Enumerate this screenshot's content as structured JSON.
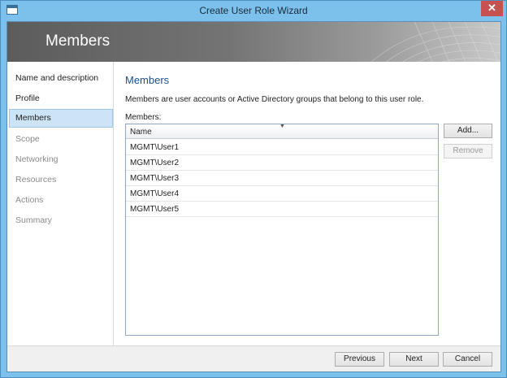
{
  "window": {
    "title": "Create User Role Wizard",
    "close_glyph": "✕"
  },
  "banner": {
    "title": "Members"
  },
  "nav": {
    "items": [
      {
        "label": "Name and description",
        "state": "enabled"
      },
      {
        "label": "Profile",
        "state": "enabled"
      },
      {
        "label": "Members",
        "state": "selected"
      },
      {
        "label": "Scope",
        "state": "disabled"
      },
      {
        "label": "Networking",
        "state": "disabled"
      },
      {
        "label": "Resources",
        "state": "disabled"
      },
      {
        "label": "Actions",
        "state": "disabled"
      },
      {
        "label": "Summary",
        "state": "disabled"
      }
    ]
  },
  "content": {
    "section_title": "Members",
    "description": "Members are user accounts or Active Directory groups that belong to this user role.",
    "members_label": "Members:",
    "grid": {
      "column_header": "Name",
      "sort_glyph": "▼",
      "rows": [
        "MGMT\\User1",
        "MGMT\\User2",
        "MGMT\\User3",
        "MGMT\\User4",
        "MGMT\\User5"
      ]
    },
    "add_button": "Add...",
    "remove_button": "Remove"
  },
  "footer": {
    "previous_button": "Previous",
    "next_button": "Next",
    "cancel_button": "Cancel"
  },
  "colors": {
    "frame": "#7cc0ec",
    "close_button": "#c75050",
    "section_title": "#1a4f8a",
    "nav_selected": "#cde4f7"
  }
}
